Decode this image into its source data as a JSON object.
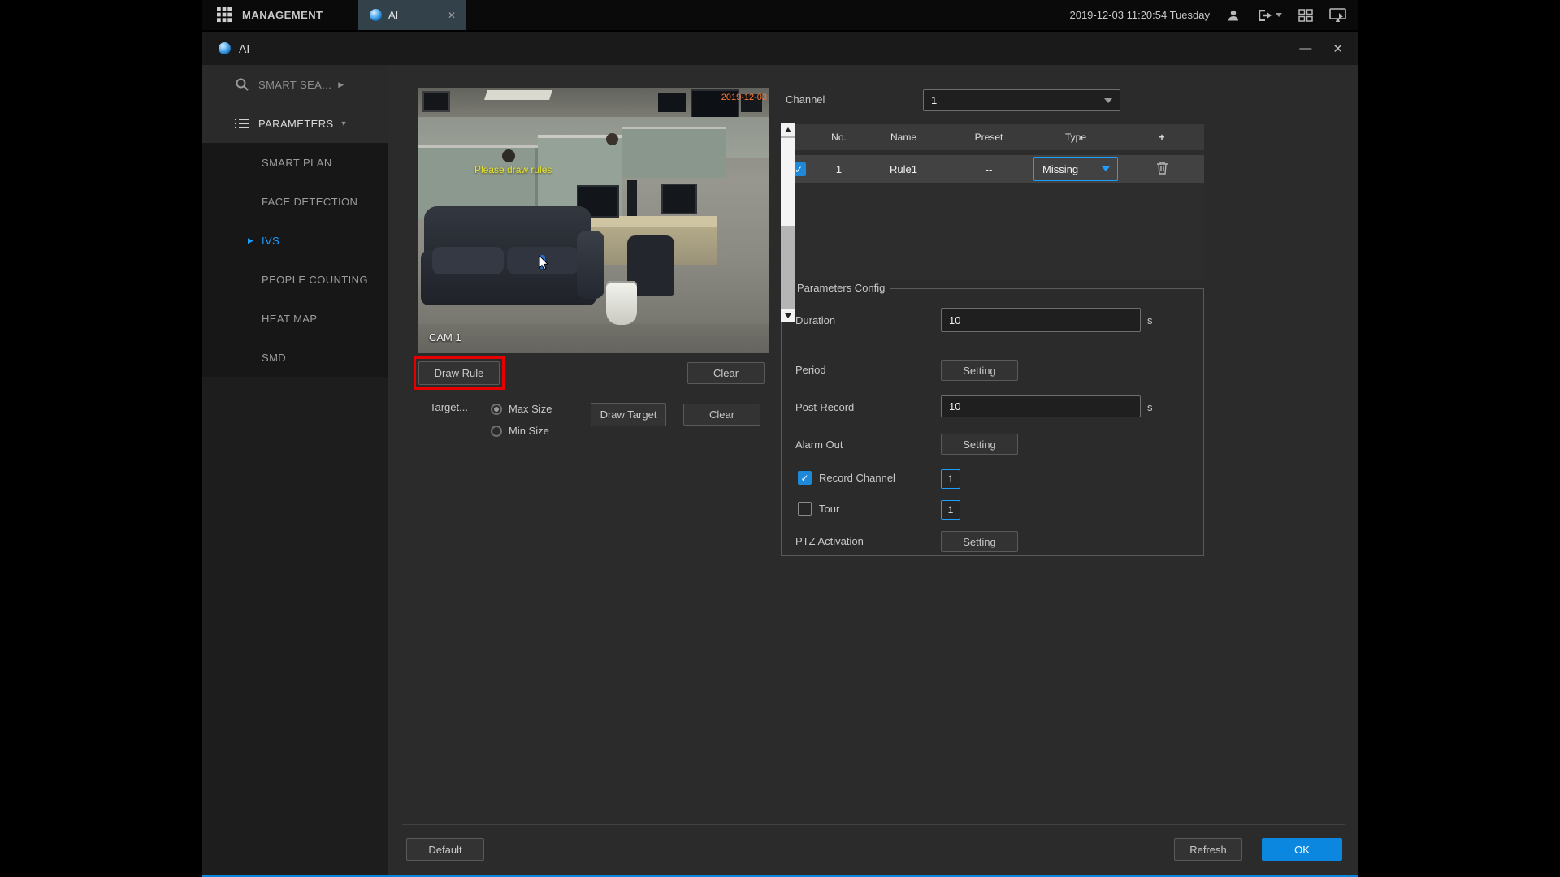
{
  "topbar": {
    "management": "MANAGEMENT",
    "tab_label": "AI",
    "tab_close": "✕",
    "datetime": "2019-12-03 11:20:54 Tuesday"
  },
  "window": {
    "title": "AI",
    "minimize": "—",
    "close": "✕"
  },
  "sidebar": {
    "items": [
      {
        "label": "SMART SEA...",
        "arrow": "▶"
      },
      {
        "label": "PARAMETERS",
        "arrow": "▼"
      },
      {
        "label": "SMART PLAN"
      },
      {
        "label": "FACE DETECTION"
      },
      {
        "label": "IVS",
        "arrow": "▶"
      },
      {
        "label": "PEOPLE COUNTING"
      },
      {
        "label": "HEAT MAP"
      },
      {
        "label": "SMD"
      }
    ]
  },
  "preview": {
    "hint": "Please draw rules",
    "camera": "CAM 1",
    "timestamp": "2019-12-03",
    "draw_rule": "Draw Rule",
    "clear": "Clear",
    "target": "Target...",
    "max_size": "Max Size",
    "min_size": "Min Size",
    "draw_target": "Draw Target",
    "target_clear": "Clear"
  },
  "channel": {
    "label": "Channel",
    "value": "1"
  },
  "table": {
    "col_no": "No.",
    "col_name": "Name",
    "col_preset": "Preset",
    "col_type": "Type",
    "add": "+",
    "row": {
      "no": "1",
      "name": "Rule1",
      "preset": "--",
      "type": "Missing"
    }
  },
  "params": {
    "title": "Parameters Config",
    "duration": "Duration",
    "duration_value": "10",
    "duration_unit": "s",
    "period": "Period",
    "period_btn": "Setting",
    "post_record": "Post-Record",
    "post_record_value": "10",
    "post_record_unit": "s",
    "alarm_out": "Alarm Out",
    "alarm_out_btn": "Setting",
    "record_channel": "Record Channel",
    "record_channel_value": "1",
    "tour": "Tour",
    "tour_value": "1",
    "ptz": "PTZ Activation",
    "ptz_btn": "Setting"
  },
  "footer": {
    "default": "Default",
    "refresh": "Refresh",
    "ok": "OK"
  },
  "colors": {
    "accent": "#1e9fff",
    "ok_blue": "#0b87e0",
    "annotation": "#e60000"
  }
}
